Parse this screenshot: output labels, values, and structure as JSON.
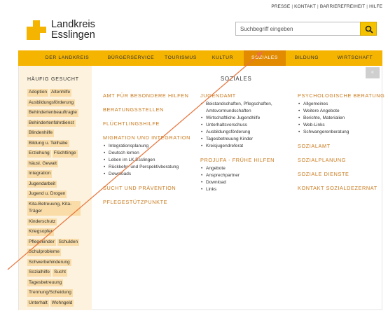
{
  "top_links": [
    "PRESSE",
    "KONTAKT",
    "BARRIEREFREIHEIT",
    "HILFE"
  ],
  "logo": {
    "line1": "Landkreis",
    "line2": "Esslingen"
  },
  "search": {
    "placeholder": "Suchbegriff eingeben"
  },
  "nav": [
    "DER LANDKREIS",
    "BÜRGERSERVICE",
    "TOURISMUS",
    "KULTUR",
    "SOZIALES",
    "BILDUNG",
    "WIRTSCHAFT"
  ],
  "nav_active": "SOZIALES",
  "sidebar": {
    "title": "HÄUFIG GESUCHT",
    "rows": [
      [
        "Adoption",
        "Altenhilfe"
      ],
      [
        "Ausbildungsförderung"
      ],
      [
        "Behindertenbeauftragte"
      ],
      [
        "Behindertenfahrdienst"
      ],
      [
        "Blindenhilfe"
      ],
      [
        "Bildung u. Teilhabe"
      ],
      [
        "Erziehung",
        "Flüchtlinge"
      ],
      [
        "häusl. Gewalt"
      ],
      [
        "Integration"
      ],
      [
        "Jugendarbeit"
      ],
      [
        "Jugend u. Drogen"
      ],
      [
        "Kita-Betreuung, Kita-Träger"
      ],
      [
        "Kinderschutz"
      ],
      [
        "Kriegsopfer"
      ],
      [
        "Pflegekinder",
        "Schulden"
      ],
      [
        "Schulprobleme"
      ],
      [
        "Schwerbehinderung"
      ],
      [
        "Sozialhilfe",
        "Sucht"
      ],
      [
        "Tagesbetreuung"
      ],
      [
        "Trennung/Scheidung"
      ],
      [
        "Unterhalt",
        "Wohngeld"
      ]
    ]
  },
  "main": {
    "title": "SOZIALES",
    "close_label": "«",
    "columns": [
      [
        {
          "heading": "AMT FÜR BESONDERE HILFEN",
          "items": []
        },
        {
          "heading": "BERATUNGSSTELLEN",
          "items": []
        },
        {
          "heading": "FLÜCHTLINGSHILFE",
          "items": []
        },
        {
          "heading": "MIGRATION UND INTEGRATION",
          "items": [
            "Integrationsplanung",
            "Deutsch lernen",
            "Leben im LK Esslingen",
            "Rückkehr- und Perspektivberatung",
            "Downloads"
          ]
        },
        {
          "heading": "SUCHT UND PRÄVENTION",
          "items": []
        },
        {
          "heading": "PFLEGESTÜTZPUNKTE",
          "items": []
        }
      ],
      [
        {
          "heading": "JUGENDAMT",
          "items": [
            "Beistandschaften, Pflegschaften, Amtsvormundschaften",
            "Wirtschaftliche Jugendhilfe",
            "Unterhaltsvorschuss",
            "Ausbildungsförderung",
            "Tagesbetreuung Kinder",
            "Kreisjugendreferat"
          ]
        },
        {
          "heading": "PROJUFA - FRÜHE HILFEN",
          "items": [
            "Angebote",
            "Ansprechpartner",
            "Download",
            "Links"
          ]
        }
      ],
      [
        {
          "heading": "PSYCHOLOGISCHE BERATUNG",
          "items": [
            "Allgemeines",
            "Weitere Angebote",
            "Berichte, Materialien",
            "Web-Links",
            "Schwangerenberatung"
          ]
        },
        {
          "heading": "SOZIALAMT",
          "items": []
        },
        {
          "heading": "SOZIALPLANUNG",
          "items": []
        },
        {
          "heading": "SOZIALE DIENSTE",
          "items": []
        },
        {
          "heading": "KONTAKT SOZIALDEZERNAT",
          "items": []
        }
      ]
    ]
  },
  "colors": {
    "brand_yellow": "#f5b400",
    "active_orange": "#e28a00",
    "heading_orange": "#c8781a",
    "sidebar_bg": "#fdf2dd",
    "tag_bg": "#f9dca7"
  }
}
